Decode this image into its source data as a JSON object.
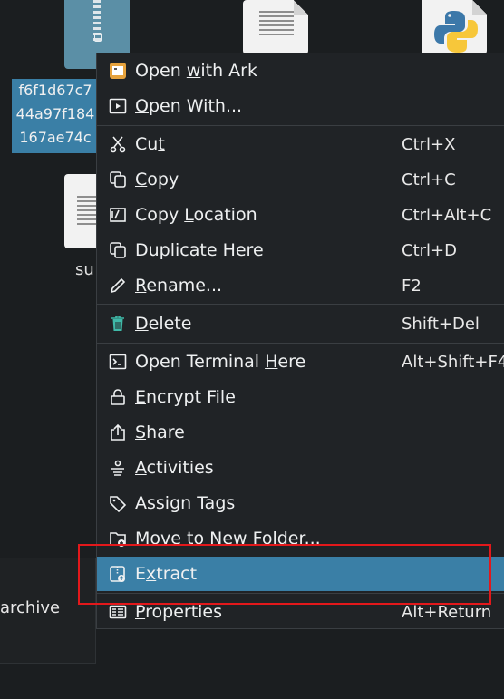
{
  "desktop": {
    "selected_file_lines": [
      "f6f1d67c7",
      "44a97f184",
      "167ae74c"
    ],
    "su_label": "su",
    "archive_label": "archive"
  },
  "menu": {
    "items": [
      {
        "pre": "Open ",
        "u": "w",
        "post": "ith Ark",
        "shortcut": "",
        "icon": "ark-icon"
      },
      {
        "pre": "",
        "u": "O",
        "post": "pen With...",
        "shortcut": "",
        "icon": "open-with-icon"
      },
      {
        "pre": "Cu",
        "u": "t",
        "post": "",
        "shortcut": "Ctrl+X",
        "icon": "cut-icon"
      },
      {
        "pre": "",
        "u": "C",
        "post": "opy",
        "shortcut": "Ctrl+C",
        "icon": "copy-icon"
      },
      {
        "pre": "Copy ",
        "u": "L",
        "post": "ocation",
        "shortcut": "Ctrl+Alt+C",
        "icon": "copy-location-icon"
      },
      {
        "pre": "",
        "u": "D",
        "post": "uplicate Here",
        "shortcut": "Ctrl+D",
        "icon": "duplicate-icon"
      },
      {
        "pre": "",
        "u": "R",
        "post": "ename...",
        "shortcut": "F2",
        "icon": "rename-icon"
      },
      {
        "pre": "",
        "u": "D",
        "post": "elete",
        "shortcut": "Shift+Del",
        "icon": "trash-icon"
      },
      {
        "pre": "Open Terminal ",
        "u": "H",
        "post": "ere",
        "shortcut": "Alt+Shift+F4",
        "icon": "terminal-icon"
      },
      {
        "pre": "",
        "u": "E",
        "post": "ncrypt File",
        "shortcut": "",
        "icon": "lock-icon"
      },
      {
        "pre": "",
        "u": "S",
        "post": "hare",
        "shortcut": "",
        "icon": "share-icon"
      },
      {
        "pre": "",
        "u": "A",
        "post": "ctivities",
        "shortcut": "",
        "icon": "activities-icon"
      },
      {
        "pre": "Assign Tags",
        "u": "",
        "post": "",
        "shortcut": "",
        "icon": "tag-icon"
      },
      {
        "pre": "Move to ",
        "u": "N",
        "post": "ew Folder...",
        "shortcut": "",
        "icon": "folder-new-icon"
      },
      {
        "pre": "E",
        "u": "x",
        "post": "tract",
        "shortcut": "",
        "icon": "extract-icon"
      },
      {
        "pre": "",
        "u": "P",
        "post": "roperties",
        "shortcut": "Alt+Return",
        "icon": "properties-icon"
      }
    ],
    "submenu_arrow": "▸"
  }
}
